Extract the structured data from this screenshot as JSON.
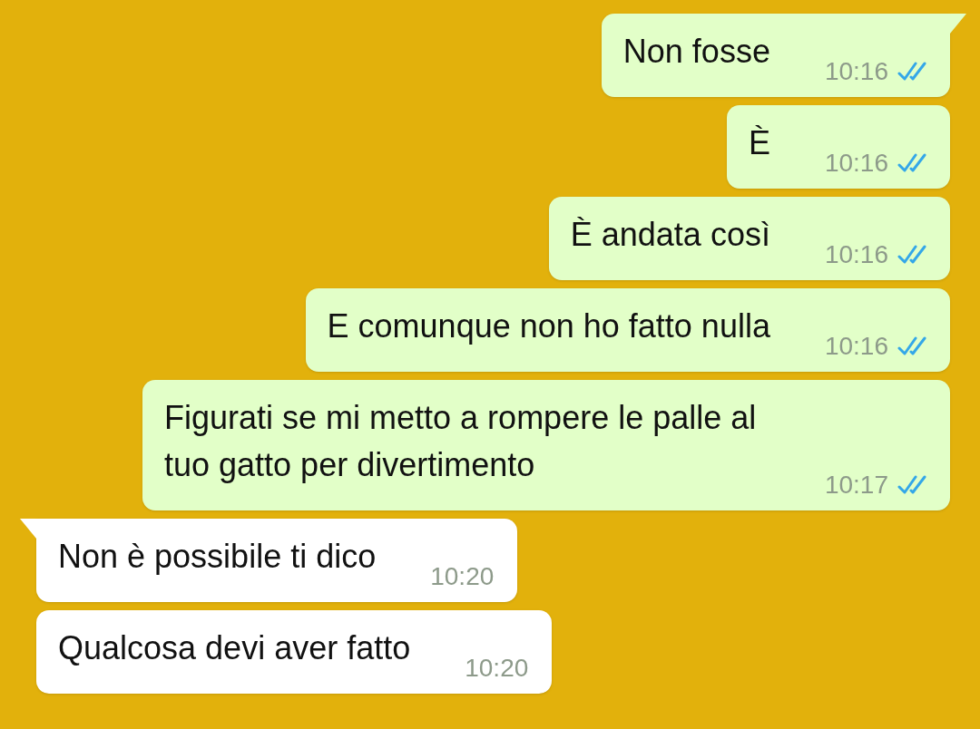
{
  "messages": [
    {
      "kind": "outgoing",
      "text": "Non fosse",
      "time": "10:16",
      "read": true,
      "tail": true
    },
    {
      "kind": "outgoing",
      "text": "È",
      "time": "10:16",
      "read": true,
      "tail": false
    },
    {
      "kind": "outgoing",
      "text": "È andata così",
      "time": "10:16",
      "read": true,
      "tail": false
    },
    {
      "kind": "outgoing",
      "text": "E comunque non ho fatto nulla",
      "time": "10:16",
      "read": true,
      "tail": false
    },
    {
      "kind": "outgoing",
      "text": "Figurati se mi metto a rompere le palle al tuo gatto per divertimento",
      "time": "10:17",
      "read": true,
      "tail": false
    },
    {
      "kind": "incoming",
      "text": "Non è possibile ti dico",
      "time": "10:20",
      "tail": true
    },
    {
      "kind": "incoming",
      "text": "Qualcosa devi aver fatto",
      "time": "10:20",
      "tail": false
    }
  ]
}
